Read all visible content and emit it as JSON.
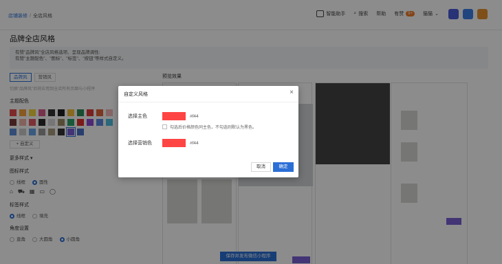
{
  "breadcrumb": {
    "first": "店铺装修",
    "sep": "/",
    "current": "全店风格"
  },
  "topnav": {
    "ai": "智能助手",
    "search": "搜索",
    "help": "帮助",
    "news": "有赞",
    "news_badge": "9+",
    "store": "猫猫"
  },
  "page": {
    "title": "品牌全店风格",
    "notice_line1": "有赞\"品牌风\"全店风格选项、呈现品牌调性;",
    "notice_line2": "有赞\"主题配色\"、\"图标\"、\"标签\"、\"按钮\"等样式自定义。"
  },
  "left": {
    "tab1": "品牌风",
    "tab2": "营销风",
    "tab_hint": "切换\"品牌风\"后将应用到全店所有页面与小程序",
    "color_section": "主题配色",
    "custom_btn": "+ 自定义",
    "more_styles": "更多样式 ▾",
    "icon_section": "图标样式",
    "icon_opt1": "线框",
    "icon_opt2": "面性",
    "tag_section": "标签样式",
    "tag_opt1": "线框",
    "tag_opt2": "填充",
    "corner_section": "角度设置",
    "corner_opt1": "直角",
    "corner_opt2": "大圆角",
    "corner_opt3": "小圆角"
  },
  "preview": {
    "title": "预览效果"
  },
  "colors": [
    "#e84d4d",
    "#f7a23e",
    "#f2d33c",
    "#d95c8a",
    "#333333",
    "#222222",
    "#f6c23b",
    "#2f8a5a",
    "#e03b3b",
    "#e2653b",
    "#f2b8b8",
    "#7a3b3b",
    "#efb3a8",
    "#e25a64",
    "#2b2b2b",
    "#d7d7d7",
    "#9b8a66",
    "#2ea36b",
    "#e23030",
    "#8e4bd6",
    "#5a8be0",
    "#4fbde0",
    "#5b8ed8",
    "#cdcdcd",
    "#6aa5e8",
    "#9a9a9a",
    "#a79b7e",
    "#333333",
    "#7a5fd6",
    "#4a72c8"
  ],
  "dialog": {
    "title": "自定义风格",
    "close": "×",
    "main_color_label": "选择主色",
    "main_color_hex": "#f44",
    "checkbox_text": "勾选后价格颜色同主色，不勾选则默认为黑色。",
    "sales_color_label": "选择营销色",
    "sales_color_hex": "#f44",
    "cancel": "取消",
    "ok": "确定"
  },
  "bottom": {
    "save_btn": "保存并发布微信小程序"
  }
}
